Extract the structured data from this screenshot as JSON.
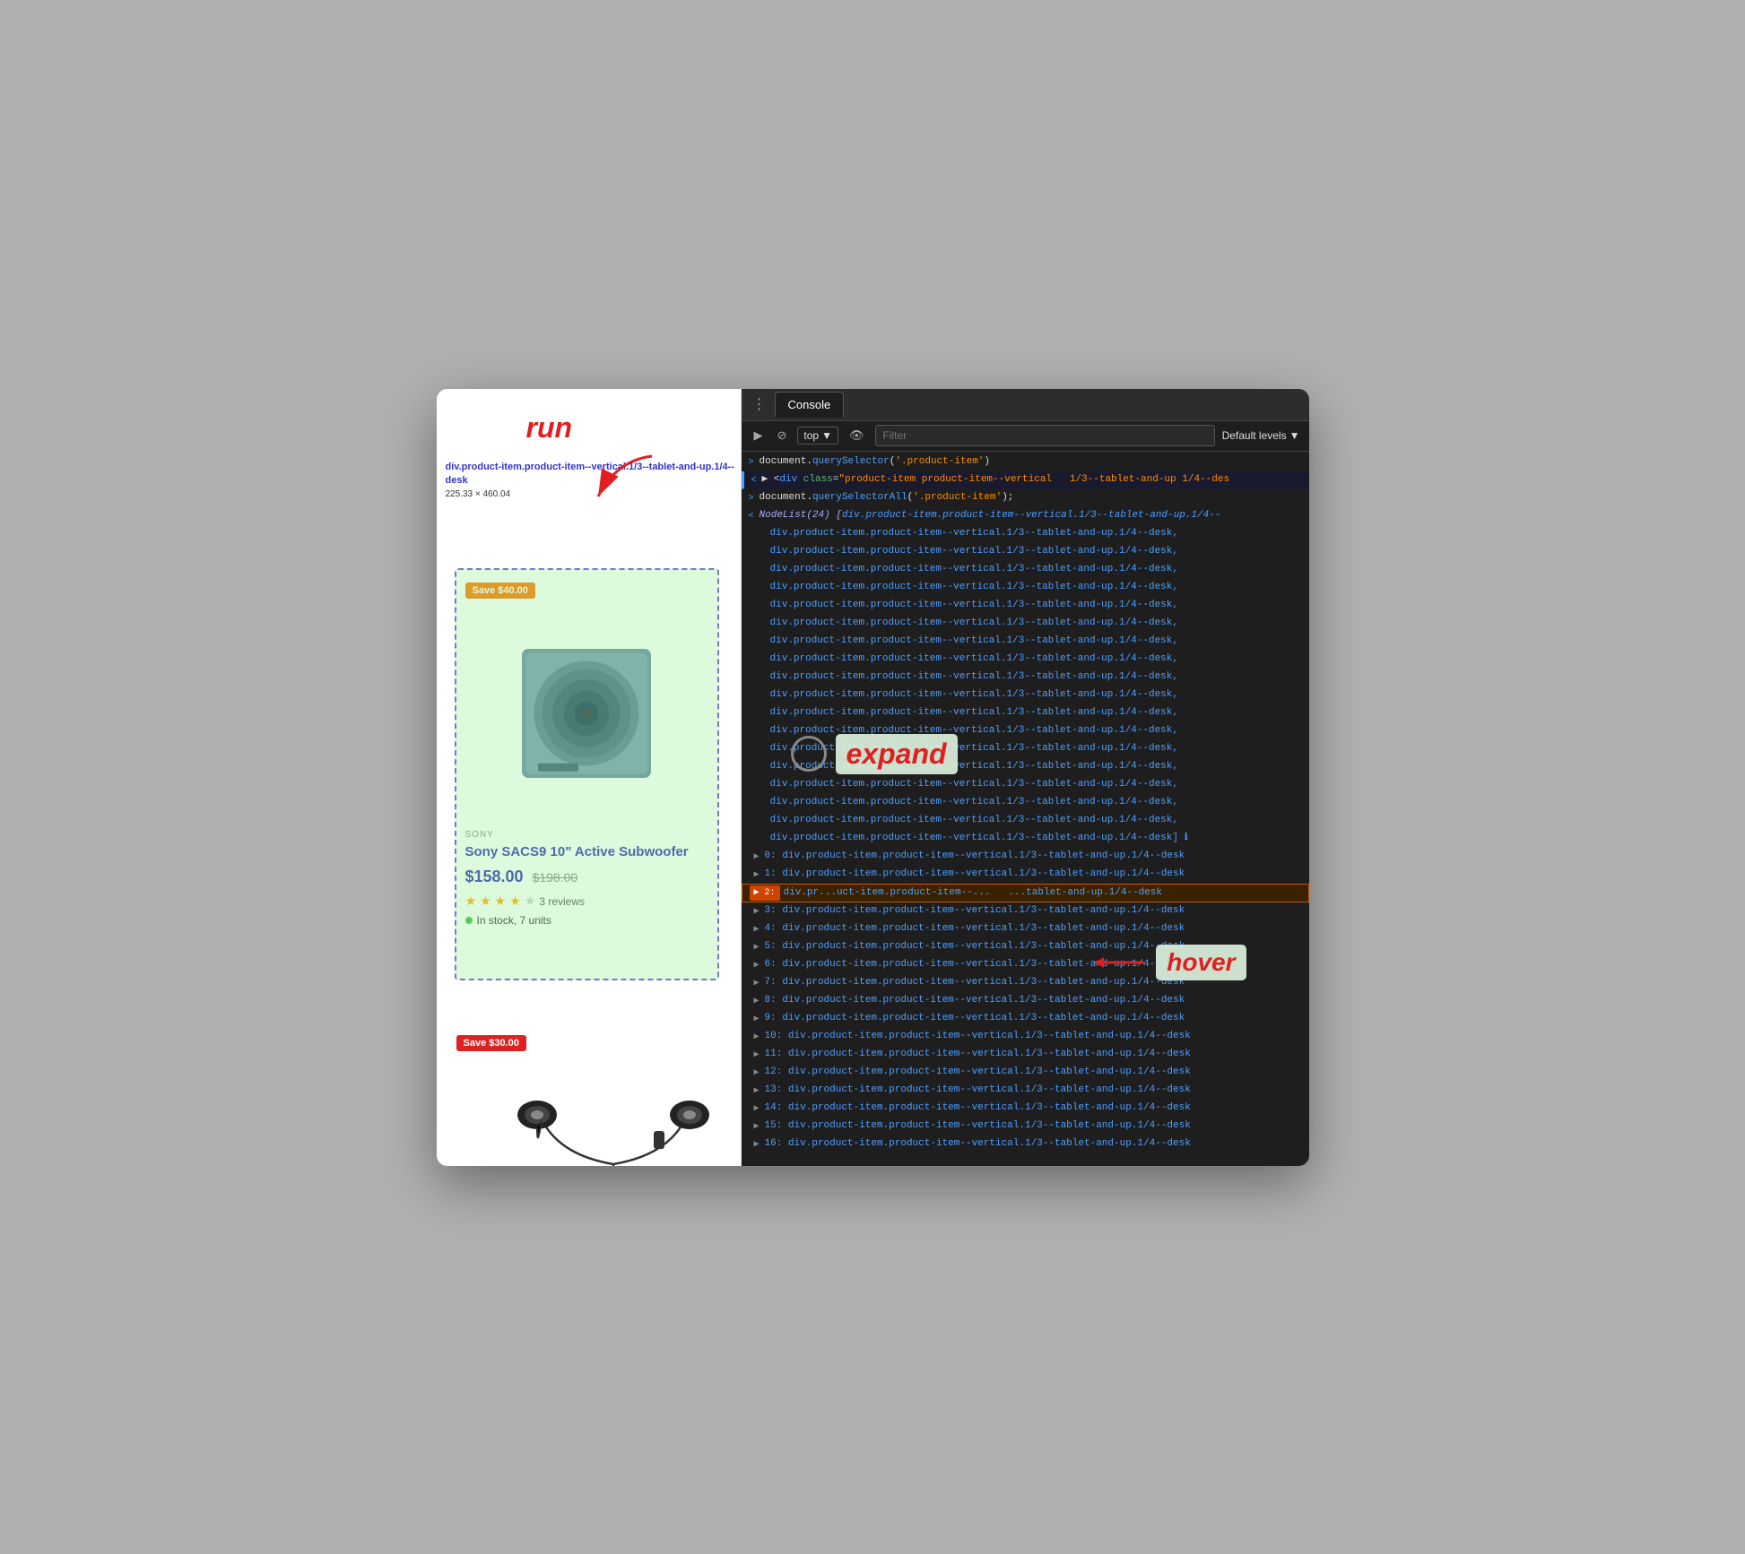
{
  "annotations": {
    "run_label": "run",
    "expand_label": "expand",
    "hover_label": "hover"
  },
  "element_tooltip": {
    "selector": "div.product-item.product-item--vertical.1/3--tablet-and-up.1/4--desk",
    "dimensions": "225.33 × 460.04"
  },
  "product1": {
    "save_badge": "Save $40.00",
    "brand": "SONY",
    "title": "Sony SACS9 10\" Active Subwoofer",
    "price_current": "$158.00",
    "price_original": "$198.00",
    "reviews_count": "3 reviews",
    "stock": "In stock, 7 units"
  },
  "product2": {
    "save_badge": "Save $30.00"
  },
  "devtools": {
    "tab_label": "Console",
    "toolbar": {
      "top_selector": "top",
      "filter_placeholder": "Filter",
      "default_levels": "Default levels"
    },
    "lines": [
      {
        "type": "user",
        "arrow": ">",
        "text": "document.querySelector('.product-item')"
      },
      {
        "type": "result",
        "arrow": "<",
        "text": "▶ <div class=\"product-item product-item--vertical   1/3--tablet-and-up 1/4--des"
      },
      {
        "type": "user",
        "arrow": ">",
        "text": "document.querySelectorAll('.product-item');"
      },
      {
        "type": "nodelist",
        "text": "NodeList(24) [div.product-item.product-item--vertical.1/3--tablet-and-up.1/4--"
      },
      {
        "type": "nodelist_item",
        "text": "  div.product-item.product-item--vertical.1/3--tablet-and-up.1/4--desk,"
      },
      {
        "type": "nodelist_item",
        "text": "  div.product-item.product-item--vertical.1/3--tablet-and-up.1/4--desk,"
      },
      {
        "type": "nodelist_item",
        "text": "  div.product-item.product-item--vertical.1/3--tablet-and-up.1/4--desk,"
      },
      {
        "type": "nodelist_item",
        "text": "  div.product-item.product-item--vertical.1/3--tablet-and-up.1/4--desk,"
      },
      {
        "type": "nodelist_item",
        "text": "  div.product-item.product-item--vertical.1/3--tablet-and-up.1/4--desk,"
      },
      {
        "type": "nodelist_item",
        "text": "  div.product-item.product-item--vertical.1/3--tablet-and-up.1/4--desk,"
      },
      {
        "type": "nodelist_item",
        "text": "  div.product-item.product-item--vertical.1/3--tablet-and-up.1/4--desk,"
      },
      {
        "type": "nodelist_item",
        "text": "  div.product-item.product-item--vertical.1/3--tablet-and-up.1/4--desk,"
      },
      {
        "type": "nodelist_item",
        "text": "  div.product-item.product-item--vertical.1/3--tablet-and-up.1/4--desk,"
      },
      {
        "type": "nodelist_item",
        "text": "  div.product-item.product-item--vertical.1/3--tablet-and-up.1/4--desk,"
      },
      {
        "type": "nodelist_item",
        "text": "  div.product-item.product-item--vertical.1/3--tablet-and-up.1/4--desk,"
      },
      {
        "type": "nodelist_item",
        "text": "  div.product-item.product-item--vertical.1/3--tablet-and-up.1/4--desk,"
      },
      {
        "type": "nodelist_item",
        "text": "  div.product-item.product-item--vertical.1/3--tablet-and-up.1/4--desk,"
      },
      {
        "type": "nodelist_item",
        "text": "  div.product-item.product-item--vertical.1/3--tablet-and-up.1/4--desk,"
      },
      {
        "type": "nodelist_item",
        "text": "  div.product-item.product-item--vertical.1/3--tablet-and-up.1/4--desk,"
      },
      {
        "type": "nodelist_item",
        "text": "  div.product-item.product-item--vertical.1/3--tablet-and-up.1/4--desk,"
      },
      {
        "type": "nodelist_item",
        "text": "  div.product-item.product-item--vertical.1/3--tablet-and-up.1/4--desk,"
      },
      {
        "type": "nodelist_item",
        "text": "  div.product-item.product-item--vertical.1/3--tablet-and-up.1/4--desk,"
      },
      {
        "type": "nodelist_item",
        "text": "  div.product-item.product-item--vertical.1/3--tablet-and-up.1/4--desk] ℹ"
      },
      {
        "type": "indexed",
        "index": "0:",
        "text": "div.product-item.product-item--vertical.1/3--tablet-and-up.1/4--desk"
      },
      {
        "type": "indexed",
        "index": "1:",
        "text": "div.product-item.product-item--vertical.1/3--tablet-and-up.1/4--desk"
      },
      {
        "type": "indexed_hover",
        "index": "2:",
        "text": "div.pro...uct-item.product-item--...   ...tablet-and-up.1/4--desk"
      },
      {
        "type": "indexed",
        "index": "3:",
        "text": "div.product-item.product-item--vertical.1/3--tablet-and-up.1/4--desk"
      },
      {
        "type": "indexed",
        "index": "4:",
        "text": "div.product-item.product-item--vertical.1/3--tablet-and-up.1/4--desk"
      },
      {
        "type": "indexed",
        "index": "5:",
        "text": "div.product-item.product-item--vertical.1/3--tablet-and-up.1/4--desk"
      },
      {
        "type": "indexed",
        "index": "6:",
        "text": "div.product-item.product-item--vertical.1/3--tablet-and-up.1/4--desk"
      },
      {
        "type": "indexed",
        "index": "7:",
        "text": "div.product-item.product-item--vertical.1/3--tablet-and-up.1/4--desk"
      },
      {
        "type": "indexed",
        "index": "8:",
        "text": "div.product-item.product-item--vertical.1/3--tablet-and-up.1/4--desk"
      },
      {
        "type": "indexed",
        "index": "9:",
        "text": "div.product-item.product-item--vertical.1/3--tablet-and-up.1/4--desk"
      },
      {
        "type": "indexed",
        "index": "10:",
        "text": "div.product-item.product-item--vertical.1/3--tablet-and-up.1/4--desk"
      },
      {
        "type": "indexed",
        "index": "11:",
        "text": "div.product-item.product-item--vertical.1/3--tablet-and-up.1/4--desk"
      },
      {
        "type": "indexed",
        "index": "12:",
        "text": "div.product-item.product-item--vertical.1/3--tablet-and-up.1/4--desk"
      },
      {
        "type": "indexed",
        "index": "13:",
        "text": "div.product-item.product-item--vertical.1/3--tablet-and-up.1/4--desk"
      },
      {
        "type": "indexed",
        "index": "14:",
        "text": "div.product-item.product-item--vertical.1/3--tablet-and-up.1/4--desk"
      },
      {
        "type": "indexed",
        "index": "15:",
        "text": "div.product-item.product-item--vertical.1/3--tablet-and-up.1/4--desk"
      },
      {
        "type": "indexed",
        "index": "16:",
        "text": "div.product-item.product-item--vertical.1/3--tablet-and-up.1/4--desk"
      }
    ]
  }
}
